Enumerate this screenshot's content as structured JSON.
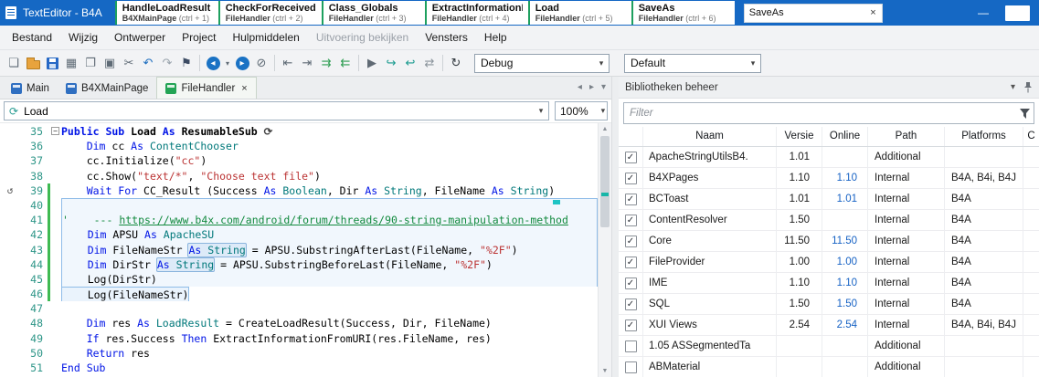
{
  "window": {
    "title": "TextEditor - B4A"
  },
  "colors": {
    "titlebar_blue": "#1568c4",
    "accent_green": "#1ea05f",
    "link_blue": "#1561c4",
    "keyword": "#0014e6",
    "type": "#00787a",
    "string": "#bb3333",
    "comment": "#128a3e",
    "line_number": "#2e9688",
    "change_bar": "#3fba52",
    "selection_border": "#8fbce8"
  },
  "titlebar": {
    "window": {
      "minimize_glyph": "—"
    },
    "search": {
      "value": "SaveAs",
      "clear_glyph": "×"
    },
    "tabs": [
      {
        "title": "HandleLoadResult",
        "module": "B4XMainPage",
        "shortcut": "(ctrl + 1)"
      },
      {
        "title": "CheckForReceivedFiles",
        "module": "FileHandler",
        "shortcut": "(ctrl + 2)"
      },
      {
        "title": "Class_Globals",
        "module": "FileHandler",
        "shortcut": "(ctrl + 3)"
      },
      {
        "title": "ExtractInformationFrom",
        "module": "FileHandler",
        "shortcut": "(ctrl + 4)"
      },
      {
        "title": "Load",
        "module": "FileHandler",
        "shortcut": "(ctrl + 5)"
      },
      {
        "title": "SaveAs",
        "module": "FileHandler",
        "shortcut": "(ctrl + 6)"
      }
    ]
  },
  "menubar": {
    "items": [
      {
        "label": "Bestand"
      },
      {
        "label": "Wijzig"
      },
      {
        "label": "Ontwerper"
      },
      {
        "label": "Project"
      },
      {
        "label": "Hulpmiddelen"
      },
      {
        "label": "Uitvoering bekijken",
        "disabled": true
      },
      {
        "label": "Vensters"
      },
      {
        "label": "Help"
      }
    ]
  },
  "toolbar": {
    "debug_mode": "Debug",
    "build_config": "Default",
    "icons": [
      {
        "name": "new-file-button",
        "glyph": "❏",
        "color": "#5f6b76"
      },
      {
        "name": "open-project-button",
        "kind": "folder"
      },
      {
        "name": "save-button",
        "kind": "floppy"
      },
      {
        "name": "modules-button",
        "glyph": "▦",
        "color": "#5f6b76"
      },
      {
        "name": "copy-button",
        "glyph": "❐",
        "color": "#5f6b76"
      },
      {
        "name": "paste-button",
        "glyph": "▣",
        "color": "#5f6b76"
      },
      {
        "name": "cut-button",
        "glyph": "✂",
        "color": "#5f6b76"
      },
      {
        "name": "undo-button",
        "glyph": "↶",
        "color": "#1f6fc0"
      },
      {
        "name": "redo-button",
        "glyph": "↷",
        "color": "#9aa4ad"
      },
      {
        "name": "bookmark-button",
        "glyph": "⚑",
        "color": "#3c4b63"
      },
      {
        "kind": "sep"
      },
      {
        "name": "navigate-back-button",
        "kind": "circle",
        "glyph": "◂"
      },
      {
        "name": "navigate-back-menu",
        "glyph": "▾",
        "color": "#5f6b76",
        "narrow": true
      },
      {
        "name": "navigate-forward-button",
        "kind": "circle",
        "glyph": "▸"
      },
      {
        "name": "clear-bookmarks-button",
        "glyph": "⊘",
        "color": "#5f6b76"
      },
      {
        "kind": "sep"
      },
      {
        "name": "outdent-button",
        "glyph": "⇤",
        "color": "#5f6b76"
      },
      {
        "name": "indent-button",
        "glyph": "⇥",
        "color": "#5f6b76"
      },
      {
        "name": "comment-button",
        "glyph": "⇉",
        "color": "#2f9e53"
      },
      {
        "name": "uncomment-button",
        "glyph": "⇇",
        "color": "#2f9e53"
      },
      {
        "kind": "sep"
      },
      {
        "name": "run-button",
        "glyph": "▶",
        "color": "#606a74"
      },
      {
        "name": "resume-button",
        "glyph": "↪",
        "color": "#189a8e"
      },
      {
        "name": "step-over-button",
        "glyph": "↩",
        "color": "#189a8e"
      },
      {
        "name": "compare-button",
        "glyph": "⇄",
        "color": "#8a949c"
      },
      {
        "kind": "sep"
      },
      {
        "name": "restart-button",
        "glyph": "↻",
        "color": "#333a40"
      }
    ]
  },
  "doc_tabs": [
    {
      "label": "Main",
      "icon_color": "#2f6fc1"
    },
    {
      "label": "B4XMainPage",
      "icon_color": "#2f6fc1"
    },
    {
      "label": "FileHandler",
      "icon_color": "#23a455",
      "active": true,
      "close": "×"
    }
  ],
  "doc_tab_controls": [
    {
      "name": "scroll-tabs-left-icon",
      "glyph": "◂"
    },
    {
      "name": "scroll-tabs-right-icon",
      "glyph": "▸"
    },
    {
      "name": "tab-list-menu-icon",
      "glyph": "▾"
    }
  ],
  "editor": {
    "nav_value": "Load",
    "nav_icon_glyph": "⟳",
    "zoom": "100%",
    "lines": [
      {
        "n": 35,
        "fold": true,
        "bold": true,
        "seg": [
          [
            "k",
            "Public Sub "
          ],
          [
            "p",
            "Load "
          ],
          [
            "k",
            "As "
          ],
          [
            "p",
            "ResumableSub "
          ],
          [
            "gl",
            "⟳"
          ]
        ]
      },
      {
        "n": 36,
        "seg": [
          [
            "k",
            "    Dim "
          ],
          [
            "p",
            "cc "
          ],
          [
            "k",
            "As "
          ],
          [
            "t",
            "ContentChooser"
          ]
        ]
      },
      {
        "n": 37,
        "seg": [
          [
            "p",
            "    cc.Initialize("
          ],
          [
            "s",
            "\"cc\""
          ],
          [
            "p",
            ")"
          ]
        ]
      },
      {
        "n": 38,
        "seg": [
          [
            "p",
            "    cc.Show("
          ],
          [
            "s",
            "\"text/*\""
          ],
          [
            "p",
            ", "
          ],
          [
            "s",
            "\"Choose text file\""
          ],
          [
            "p",
            ")"
          ]
        ]
      },
      {
        "n": 39,
        "chg": true,
        "gut": "↺",
        "seg": [
          [
            "k",
            "    Wait For "
          ],
          [
            "p",
            "CC_Result (Success "
          ],
          [
            "k",
            "As "
          ],
          [
            "t",
            "Boolean"
          ],
          [
            "p",
            ", Dir "
          ],
          [
            "k",
            "As "
          ],
          [
            "t",
            "String"
          ],
          [
            "p",
            ", FileName "
          ],
          [
            "k",
            "As "
          ],
          [
            "t",
            "String"
          ],
          [
            "p",
            ")"
          ]
        ]
      },
      {
        "n": 40,
        "chg": true,
        "cls": "sel selTop",
        "mark": true,
        "seg": []
      },
      {
        "n": 41,
        "chg": true,
        "cls": "sel",
        "seg": [
          [
            "c",
            "'    --- "
          ],
          [
            "cl",
            "https://www.b4x.com/android/forum/threads/90-string-manipulation-method"
          ]
        ]
      },
      {
        "n": 42,
        "chg": true,
        "cls": "sel",
        "seg": [
          [
            "k",
            "    Dim "
          ],
          [
            "p",
            "APSU "
          ],
          [
            "k",
            "As "
          ],
          [
            "t",
            "ApacheSU"
          ]
        ]
      },
      {
        "n": 43,
        "chg": true,
        "cls": "sel",
        "seg": [
          [
            "k",
            "    Dim "
          ],
          [
            "p",
            "FileNameStr "
          ],
          [
            "hl",
            [
              [
                "k",
                "As "
              ],
              [
                "t",
                "String"
              ]
            ]
          ],
          [
            "p",
            " = APSU.SubstringAfterLast(FileName, "
          ],
          [
            "s",
            "\"%2F\""
          ],
          [
            "p",
            ")"
          ]
        ]
      },
      {
        "n": 44,
        "chg": true,
        "cls": "sel",
        "seg": [
          [
            "k",
            "    Dim "
          ],
          [
            "p",
            "DirStr "
          ],
          [
            "hl",
            [
              [
                "k",
                "As "
              ],
              [
                "t",
                "String"
              ]
            ]
          ],
          [
            "p",
            " = APSU.SubstringBeforeLast(FileName, "
          ],
          [
            "s",
            "\"%2F\""
          ],
          [
            "p",
            ")"
          ]
        ]
      },
      {
        "n": 45,
        "chg": true,
        "cls": "sel",
        "seg": [
          [
            "p",
            "    Log(DirStr)"
          ]
        ]
      },
      {
        "n": 46,
        "chg": true,
        "selend": true,
        "seg": [
          [
            "p",
            "    Log(FileNameStr)"
          ]
        ]
      },
      {
        "n": 47,
        "seg": []
      },
      {
        "n": 48,
        "seg": [
          [
            "k",
            "    Dim "
          ],
          [
            "p",
            "res "
          ],
          [
            "k",
            "As "
          ],
          [
            "t",
            "LoadResult"
          ],
          [
            "p",
            " = CreateLoadResult(Success, Dir, FileName)"
          ]
        ]
      },
      {
        "n": 49,
        "seg": [
          [
            "k",
            "    If "
          ],
          [
            "p",
            "res.Success "
          ],
          [
            "k",
            "Then "
          ],
          [
            "p",
            "ExtractInformationFromURI(res.FileName, res)"
          ]
        ]
      },
      {
        "n": 50,
        "seg": [
          [
            "k",
            "    Return "
          ],
          [
            "p",
            "res"
          ]
        ]
      },
      {
        "n": 51,
        "seg": [
          [
            "k",
            "End Sub"
          ]
        ]
      }
    ]
  },
  "library_panel": {
    "title": "Bibliotheken beheer",
    "filter_placeholder": "Filter",
    "columns": [
      "Naam",
      "Versie",
      "Online",
      "Path",
      "Platforms",
      "C"
    ],
    "rows": [
      {
        "checked": true,
        "name": "ApacheStringUtilsB4.",
        "versie": "1.01",
        "online": "",
        "path": "Additional",
        "platforms": ""
      },
      {
        "checked": true,
        "name": "B4XPages",
        "versie": "1.10",
        "online": "1.10",
        "path": "Internal",
        "platforms": "B4A, B4i, B4J"
      },
      {
        "checked": true,
        "name": "BCToast",
        "versie": "1.01",
        "online": "1.01",
        "path": "Internal",
        "platforms": "B4A"
      },
      {
        "checked": true,
        "name": "ContentResolver",
        "versie": "1.50",
        "online": "",
        "path": "Internal",
        "platforms": "B4A"
      },
      {
        "checked": true,
        "name": "Core",
        "versie": "11.50",
        "online": "11.50",
        "path": "Internal",
        "platforms": "B4A"
      },
      {
        "checked": true,
        "name": "FileProvider",
        "versie": "1.00",
        "online": "1.00",
        "path": "Internal",
        "platforms": "B4A"
      },
      {
        "checked": true,
        "name": "IME",
        "versie": "1.10",
        "online": "1.10",
        "path": "Internal",
        "platforms": "B4A"
      },
      {
        "checked": true,
        "name": "SQL",
        "versie": "1.50",
        "online": "1.50",
        "path": "Internal",
        "platforms": "B4A"
      },
      {
        "checked": true,
        "name": "XUI Views",
        "versie": "2.54",
        "online": "2.54",
        "path": "Internal",
        "platforms": "B4A, B4i, B4J"
      },
      {
        "checked": false,
        "name": "1.05 ASSegmentedTa",
        "versie": "",
        "online": "",
        "path": "Additional",
        "platforms": ""
      },
      {
        "checked": false,
        "name": "ABMaterial",
        "versie": "",
        "online": "",
        "path": "Additional",
        "platforms": ""
      }
    ]
  }
}
